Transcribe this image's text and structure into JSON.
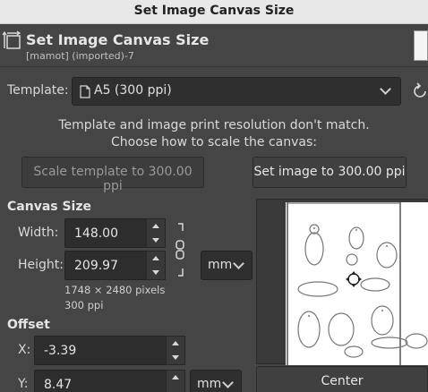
{
  "window": {
    "title": "Set Image Canvas Size"
  },
  "header": {
    "title": "Set Image Canvas Size",
    "subtitle": "[mamot] (imported)-7"
  },
  "template": {
    "label": "Template:",
    "value": "A5 (300 ppi)"
  },
  "message": {
    "line1": "Template and image print resolution don't match.",
    "line2": "Choose how to scale the canvas:"
  },
  "buttons": {
    "scale_template": "Scale template to 300.00 ppi",
    "set_image": "Set image to 300.00 ppi",
    "center": "Center"
  },
  "canvas_size": {
    "heading": "Canvas Size",
    "width_label": "Width:",
    "width_value": "148.00",
    "height_label": "Height:",
    "height_value": "209.97",
    "unit": "mm",
    "pixels": "1748 × 2480 pixels",
    "ppi": "300 ppi"
  },
  "offset": {
    "heading": "Offset",
    "x_label": "X:",
    "x_value": "-3.39",
    "y_label": "Y:",
    "y_value": "8.47",
    "unit": "mm"
  }
}
